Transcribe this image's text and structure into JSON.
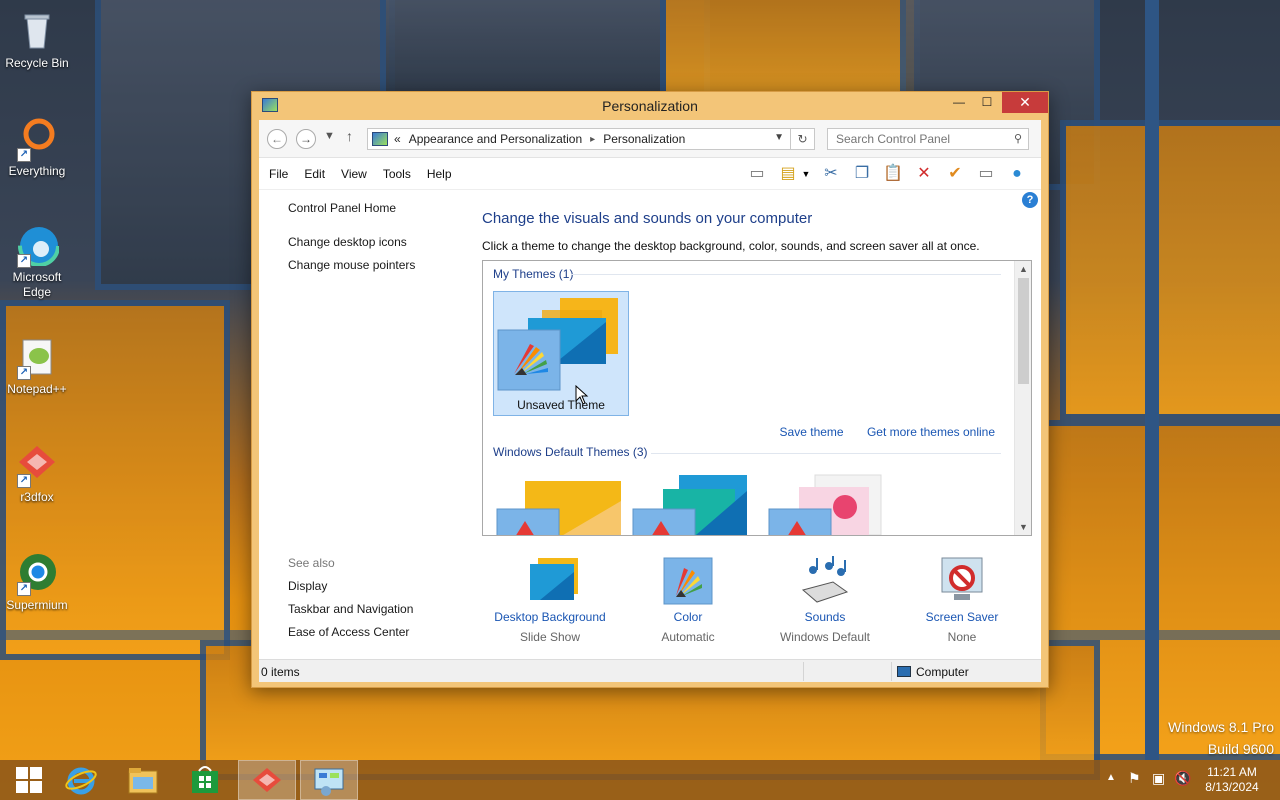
{
  "desktop": {
    "icons": [
      {
        "label": "Recycle Bin",
        "icon": "recycle-bin-icon"
      },
      {
        "label": "Everything",
        "icon": "everything-icon"
      },
      {
        "label": "Microsoft Edge",
        "icon": "edge-icon"
      },
      {
        "label": "Notepad++",
        "icon": "notepadpp-icon"
      },
      {
        "label": "r3dfox",
        "icon": "r3dfox-icon"
      },
      {
        "label": "Supermium",
        "icon": "supermium-icon"
      }
    ],
    "watermark": {
      "line1": "Windows 8.1 Pro",
      "line2": "Build 9600"
    }
  },
  "window": {
    "title": "Personalization",
    "close_glyph": "✕",
    "minimize_glyph": "—",
    "maximize_glyph": "☐",
    "breadcrumb": {
      "lead": "«",
      "part1": "Appearance and Personalization",
      "sep": "▸",
      "part2": "Personalization"
    },
    "search_placeholder": "Search Control Panel",
    "menu": [
      "File",
      "Edit",
      "View",
      "Tools",
      "Help"
    ],
    "left": {
      "home": "Control Panel Home",
      "links": [
        "Change desktop icons",
        "Change mouse pointers"
      ],
      "see_also_label": "See also",
      "see_also": [
        "Display",
        "Taskbar and Navigation",
        "Ease of Access Center"
      ]
    },
    "heading": "Change the visuals and sounds on your computer",
    "subheading": "Click a theme to change the desktop background, color, sounds, and screen saver all at once.",
    "my_themes_label": "My Themes (1)",
    "unsaved_theme": "Unsaved Theme",
    "save_theme": "Save theme",
    "get_more": "Get more themes online",
    "default_themes_label": "Windows Default Themes (3)",
    "bottom": [
      {
        "label": "Desktop Background",
        "value": "Slide Show"
      },
      {
        "label": "Color",
        "value": "Automatic"
      },
      {
        "label": "Sounds",
        "value": "Windows Default"
      },
      {
        "label": "Screen Saver",
        "value": "None"
      }
    ],
    "status_items": "0 items",
    "status_location": "Computer"
  },
  "taskbar": {
    "time": "11:21 AM",
    "date": "8/13/2024"
  },
  "colors": {
    "accent": "#1e3f8a",
    "link": "#1a56b3",
    "titlebar": "#f3c578",
    "close": "#c73b3b"
  }
}
